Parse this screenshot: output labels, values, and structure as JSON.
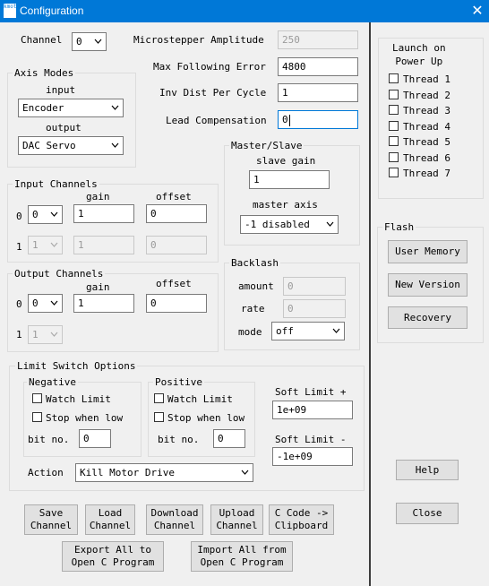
{
  "window": {
    "title": "Configuration",
    "icon": "kmotion-app-icon",
    "icon_text": "kmotion"
  },
  "channel": {
    "label": "Channel",
    "value": "0"
  },
  "microstepper_amplitude": {
    "label": "Microstepper Amplitude",
    "value": "250"
  },
  "max_following_error": {
    "label": "Max Following Error",
    "value": "4800"
  },
  "inv_dist_per_cycle": {
    "label": "Inv Dist Per Cycle",
    "value": "1"
  },
  "lead_compensation": {
    "label": "Lead Compensation",
    "value": "0"
  },
  "axis_modes": {
    "title": "Axis Modes",
    "input_label": "input",
    "input_value": "Encoder",
    "output_label": "output",
    "output_value": "DAC Servo"
  },
  "master_slave": {
    "title": "Master/Slave",
    "slave_gain_label": "slave gain",
    "slave_gain_value": "1",
    "master_axis_label": "master axis",
    "master_axis_value": "-1 disabled"
  },
  "input_channels": {
    "title": "Input Channels",
    "gain_header": "gain",
    "offset_header": "offset",
    "rows": [
      {
        "index": "0",
        "channel": "0",
        "gain": "1",
        "offset": "0",
        "enabled": true
      },
      {
        "index": "1",
        "channel": "1",
        "gain": "1",
        "offset": "0",
        "enabled": false
      }
    ]
  },
  "output_channels": {
    "title": "Output Channels",
    "gain_header": "gain",
    "offset_header": "offset",
    "rows": [
      {
        "index": "0",
        "channel": "0",
        "gain": "1",
        "offset": "0",
        "enabled": true
      },
      {
        "index": "1",
        "channel": "1",
        "enabled": false
      }
    ]
  },
  "backlash": {
    "title": "Backlash",
    "amount_label": "amount",
    "amount_value": "0",
    "rate_label": "rate",
    "rate_value": "0",
    "mode_label": "mode",
    "mode_value": "off"
  },
  "limit_switch": {
    "title": "Limit Switch Options",
    "negative": {
      "title": "Negative",
      "watch_limit": "Watch Limit",
      "stop_when_low": "Stop when low",
      "bit_no_label": "bit no.",
      "bit_no_value": "0"
    },
    "positive": {
      "title": "Positive",
      "watch_limit": "Watch Limit",
      "stop_when_low": "Stop when low",
      "bit_no_label": "bit no.",
      "bit_no_value": "0"
    },
    "soft_limit_plus_label": "Soft Limit +",
    "soft_limit_plus_value": "1e+09",
    "soft_limit_minus_label": "Soft Limit -",
    "soft_limit_minus_value": "-1e+09",
    "action_label": "Action",
    "action_value": "Kill Motor Drive"
  },
  "bottom_buttons": {
    "save_channel": "Save\nChannel",
    "load_channel": "Load\nChannel",
    "download_channel": "Download\nChannel",
    "upload_channel": "Upload\nChannel",
    "c_code_clipboard": "C Code ->\nClipboard",
    "export_all": "Export All to\nOpen C Program",
    "import_all": "Import All from\nOpen C Program"
  },
  "launch_on_power_up": {
    "title": "Launch on\nPower Up",
    "threads": [
      "Thread 1",
      "Thread 2",
      "Thread 3",
      "Thread 4",
      "Thread 5",
      "Thread 6",
      "Thread 7"
    ]
  },
  "flash": {
    "title": "Flash",
    "user_memory": "User Memory",
    "new_version": "New Version",
    "recovery": "Recovery"
  },
  "help_button": "Help",
  "close_button": "Close"
}
